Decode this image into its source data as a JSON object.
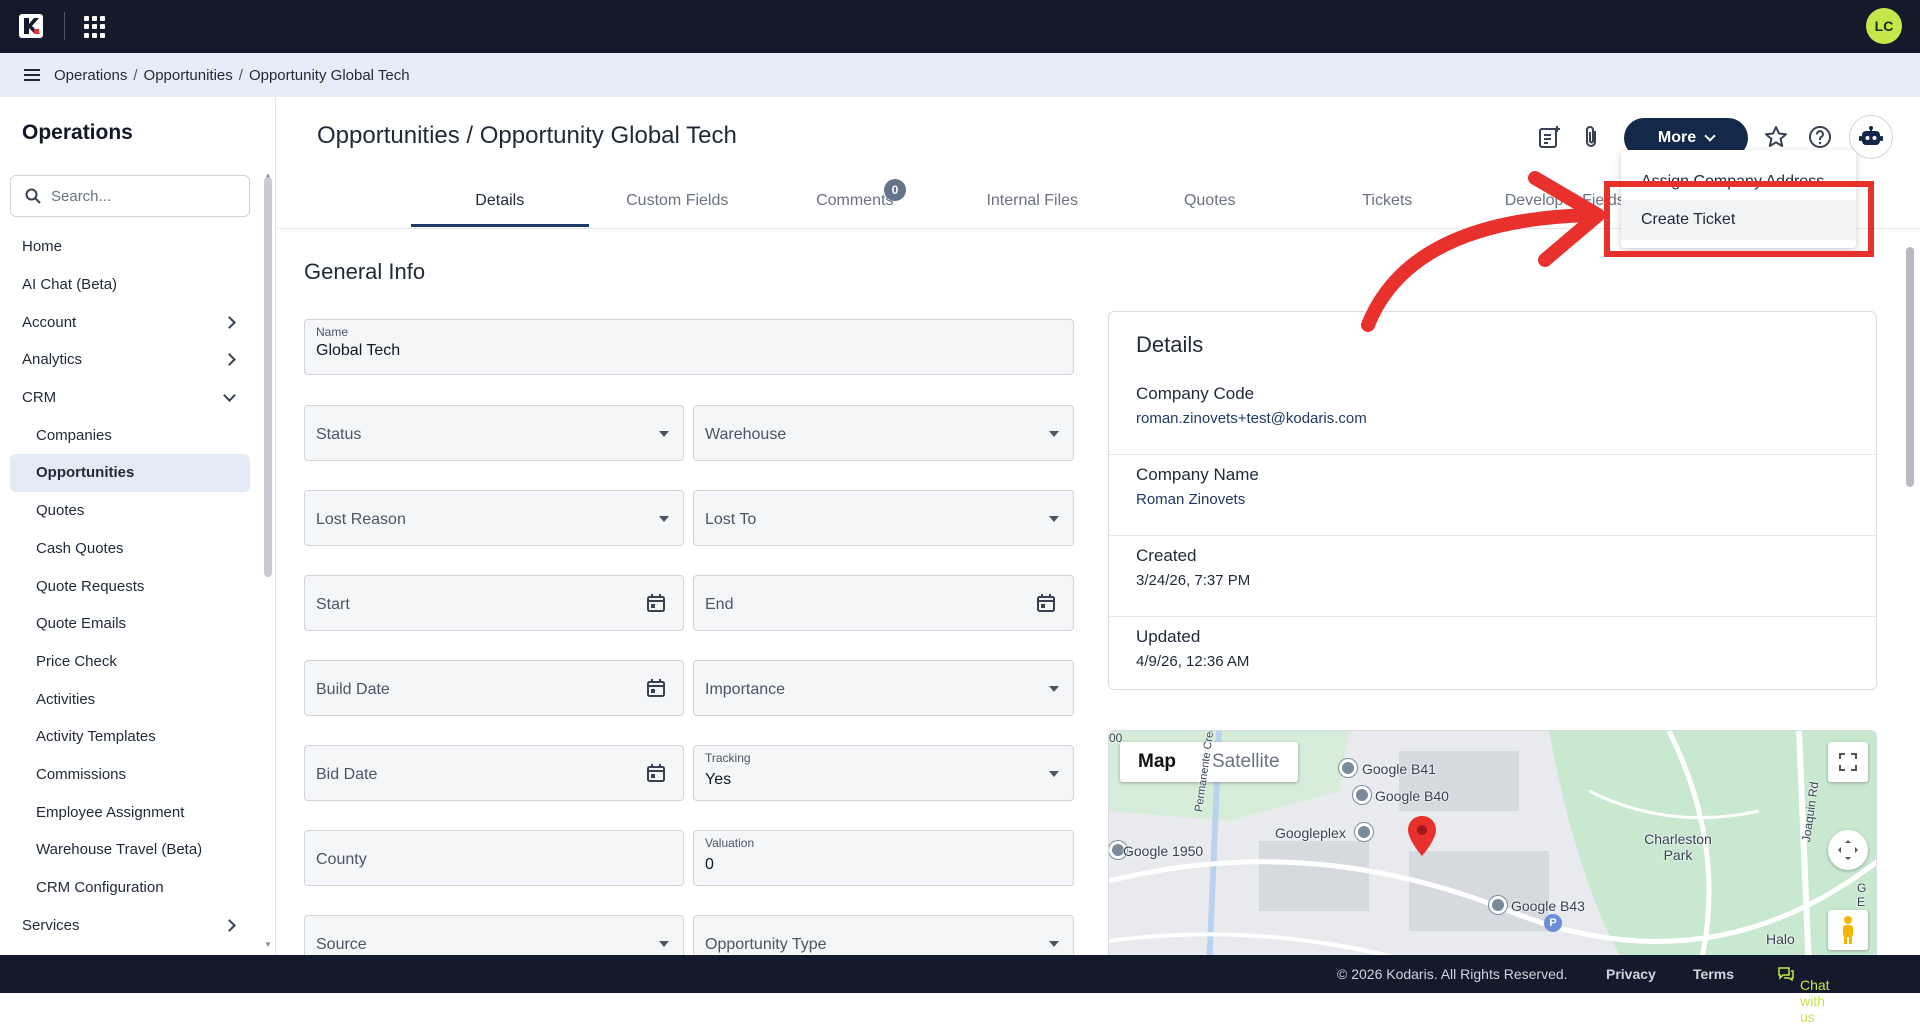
{
  "user": {
    "initials": "LC"
  },
  "breadcrumb": [
    "Operations",
    "Opportunities",
    "Opportunity Global Tech"
  ],
  "sidebar": {
    "title": "Operations",
    "search_placeholder": "Search...",
    "items": [
      {
        "label": "Home"
      },
      {
        "label": "AI Chat (Beta)"
      },
      {
        "label": "Account"
      },
      {
        "label": "Analytics"
      },
      {
        "label": "CRM"
      },
      {
        "label": "Companies"
      },
      {
        "label": "Opportunities"
      },
      {
        "label": "Quotes"
      },
      {
        "label": "Cash Quotes"
      },
      {
        "label": "Quote Requests"
      },
      {
        "label": "Quote Emails"
      },
      {
        "label": "Price Check"
      },
      {
        "label": "Activities"
      },
      {
        "label": "Activity Templates"
      },
      {
        "label": "Commissions"
      },
      {
        "label": "Employee Assignment"
      },
      {
        "label": "Warehouse Travel (Beta)"
      },
      {
        "label": "CRM Configuration"
      },
      {
        "label": "Services"
      }
    ]
  },
  "header": {
    "title": "Opportunities / Opportunity Global Tech",
    "more_label": "More"
  },
  "tabs": [
    {
      "label": "Details"
    },
    {
      "label": "Custom Fields"
    },
    {
      "label": "Comments",
      "badge": "0"
    },
    {
      "label": "Internal Files"
    },
    {
      "label": "Quotes"
    },
    {
      "label": "Tickets"
    },
    {
      "label": "Developer Fields"
    }
  ],
  "dropdown": {
    "items": [
      "Assign Company Address",
      "Create Ticket"
    ]
  },
  "general_info": {
    "title": "General Info",
    "name_label": "Name",
    "name_value": "Global Tech",
    "status": "Status",
    "warehouse": "Warehouse",
    "lost_reason": "Lost Reason",
    "lost_to": "Lost To",
    "start": "Start",
    "end": "End",
    "build_date": "Build Date",
    "importance": "Importance",
    "bid_date": "Bid Date",
    "tracking_label": "Tracking",
    "tracking_value": "Yes",
    "county": "County",
    "valuation_label": "Valuation",
    "valuation_value": "0",
    "source": "Source",
    "opportunity_type": "Opportunity Type"
  },
  "details": {
    "title": "Details",
    "rows": [
      {
        "key": "Company Code",
        "value": "roman.zinovets+test@kodaris.com"
      },
      {
        "key": "Company Name",
        "value": "Roman Zinovets"
      },
      {
        "key": "Created",
        "value": "3/24/26, 7:37 PM"
      },
      {
        "key": "Updated",
        "value": "4/9/26, 12:36 AM"
      }
    ]
  },
  "map": {
    "map_tab": "Map",
    "satellite_tab": "Satellite",
    "labels": [
      "Google B41",
      "Google B40",
      "Googleplex",
      "Google 1950",
      "Google B43",
      "Charleston Park",
      "Permanente Creek",
      "Joaquin Rd",
      "Halo",
      "00",
      "G",
      "E",
      "P"
    ]
  },
  "footer": {
    "copyright": "© 2026 Kodaris. All Rights Reserved.",
    "privacy": "Privacy",
    "terms": "Terms",
    "chat": "Chat with us"
  }
}
